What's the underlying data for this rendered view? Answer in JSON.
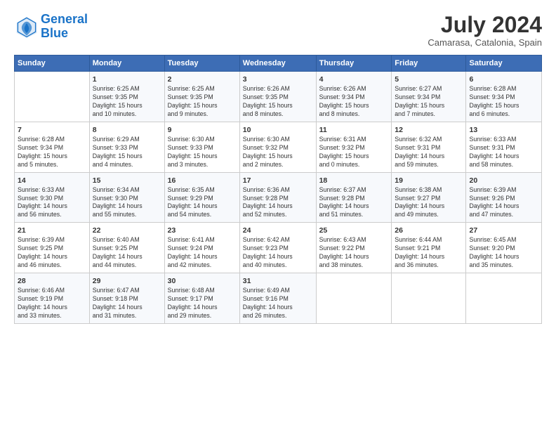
{
  "header": {
    "logo_line1": "General",
    "logo_line2": "Blue",
    "month_year": "July 2024",
    "location": "Camarasa, Catalonia, Spain"
  },
  "weekdays": [
    "Sunday",
    "Monday",
    "Tuesday",
    "Wednesday",
    "Thursday",
    "Friday",
    "Saturday"
  ],
  "weeks": [
    [
      {
        "day": "",
        "content": ""
      },
      {
        "day": "1",
        "content": "Sunrise: 6:25 AM\nSunset: 9:35 PM\nDaylight: 15 hours\nand 10 minutes."
      },
      {
        "day": "2",
        "content": "Sunrise: 6:25 AM\nSunset: 9:35 PM\nDaylight: 15 hours\nand 9 minutes."
      },
      {
        "day": "3",
        "content": "Sunrise: 6:26 AM\nSunset: 9:35 PM\nDaylight: 15 hours\nand 8 minutes."
      },
      {
        "day": "4",
        "content": "Sunrise: 6:26 AM\nSunset: 9:34 PM\nDaylight: 15 hours\nand 8 minutes."
      },
      {
        "day": "5",
        "content": "Sunrise: 6:27 AM\nSunset: 9:34 PM\nDaylight: 15 hours\nand 7 minutes."
      },
      {
        "day": "6",
        "content": "Sunrise: 6:28 AM\nSunset: 9:34 PM\nDaylight: 15 hours\nand 6 minutes."
      }
    ],
    [
      {
        "day": "7",
        "content": "Sunrise: 6:28 AM\nSunset: 9:34 PM\nDaylight: 15 hours\nand 5 minutes."
      },
      {
        "day": "8",
        "content": "Sunrise: 6:29 AM\nSunset: 9:33 PM\nDaylight: 15 hours\nand 4 minutes."
      },
      {
        "day": "9",
        "content": "Sunrise: 6:30 AM\nSunset: 9:33 PM\nDaylight: 15 hours\nand 3 minutes."
      },
      {
        "day": "10",
        "content": "Sunrise: 6:30 AM\nSunset: 9:32 PM\nDaylight: 15 hours\nand 2 minutes."
      },
      {
        "day": "11",
        "content": "Sunrise: 6:31 AM\nSunset: 9:32 PM\nDaylight: 15 hours\nand 0 minutes."
      },
      {
        "day": "12",
        "content": "Sunrise: 6:32 AM\nSunset: 9:31 PM\nDaylight: 14 hours\nand 59 minutes."
      },
      {
        "day": "13",
        "content": "Sunrise: 6:33 AM\nSunset: 9:31 PM\nDaylight: 14 hours\nand 58 minutes."
      }
    ],
    [
      {
        "day": "14",
        "content": "Sunrise: 6:33 AM\nSunset: 9:30 PM\nDaylight: 14 hours\nand 56 minutes."
      },
      {
        "day": "15",
        "content": "Sunrise: 6:34 AM\nSunset: 9:30 PM\nDaylight: 14 hours\nand 55 minutes."
      },
      {
        "day": "16",
        "content": "Sunrise: 6:35 AM\nSunset: 9:29 PM\nDaylight: 14 hours\nand 54 minutes."
      },
      {
        "day": "17",
        "content": "Sunrise: 6:36 AM\nSunset: 9:28 PM\nDaylight: 14 hours\nand 52 minutes."
      },
      {
        "day": "18",
        "content": "Sunrise: 6:37 AM\nSunset: 9:28 PM\nDaylight: 14 hours\nand 51 minutes."
      },
      {
        "day": "19",
        "content": "Sunrise: 6:38 AM\nSunset: 9:27 PM\nDaylight: 14 hours\nand 49 minutes."
      },
      {
        "day": "20",
        "content": "Sunrise: 6:39 AM\nSunset: 9:26 PM\nDaylight: 14 hours\nand 47 minutes."
      }
    ],
    [
      {
        "day": "21",
        "content": "Sunrise: 6:39 AM\nSunset: 9:25 PM\nDaylight: 14 hours\nand 46 minutes."
      },
      {
        "day": "22",
        "content": "Sunrise: 6:40 AM\nSunset: 9:25 PM\nDaylight: 14 hours\nand 44 minutes."
      },
      {
        "day": "23",
        "content": "Sunrise: 6:41 AM\nSunset: 9:24 PM\nDaylight: 14 hours\nand 42 minutes."
      },
      {
        "day": "24",
        "content": "Sunrise: 6:42 AM\nSunset: 9:23 PM\nDaylight: 14 hours\nand 40 minutes."
      },
      {
        "day": "25",
        "content": "Sunrise: 6:43 AM\nSunset: 9:22 PM\nDaylight: 14 hours\nand 38 minutes."
      },
      {
        "day": "26",
        "content": "Sunrise: 6:44 AM\nSunset: 9:21 PM\nDaylight: 14 hours\nand 36 minutes."
      },
      {
        "day": "27",
        "content": "Sunrise: 6:45 AM\nSunset: 9:20 PM\nDaylight: 14 hours\nand 35 minutes."
      }
    ],
    [
      {
        "day": "28",
        "content": "Sunrise: 6:46 AM\nSunset: 9:19 PM\nDaylight: 14 hours\nand 33 minutes."
      },
      {
        "day": "29",
        "content": "Sunrise: 6:47 AM\nSunset: 9:18 PM\nDaylight: 14 hours\nand 31 minutes."
      },
      {
        "day": "30",
        "content": "Sunrise: 6:48 AM\nSunset: 9:17 PM\nDaylight: 14 hours\nand 29 minutes."
      },
      {
        "day": "31",
        "content": "Sunrise: 6:49 AM\nSunset: 9:16 PM\nDaylight: 14 hours\nand 26 minutes."
      },
      {
        "day": "",
        "content": ""
      },
      {
        "day": "",
        "content": ""
      },
      {
        "day": "",
        "content": ""
      }
    ]
  ]
}
